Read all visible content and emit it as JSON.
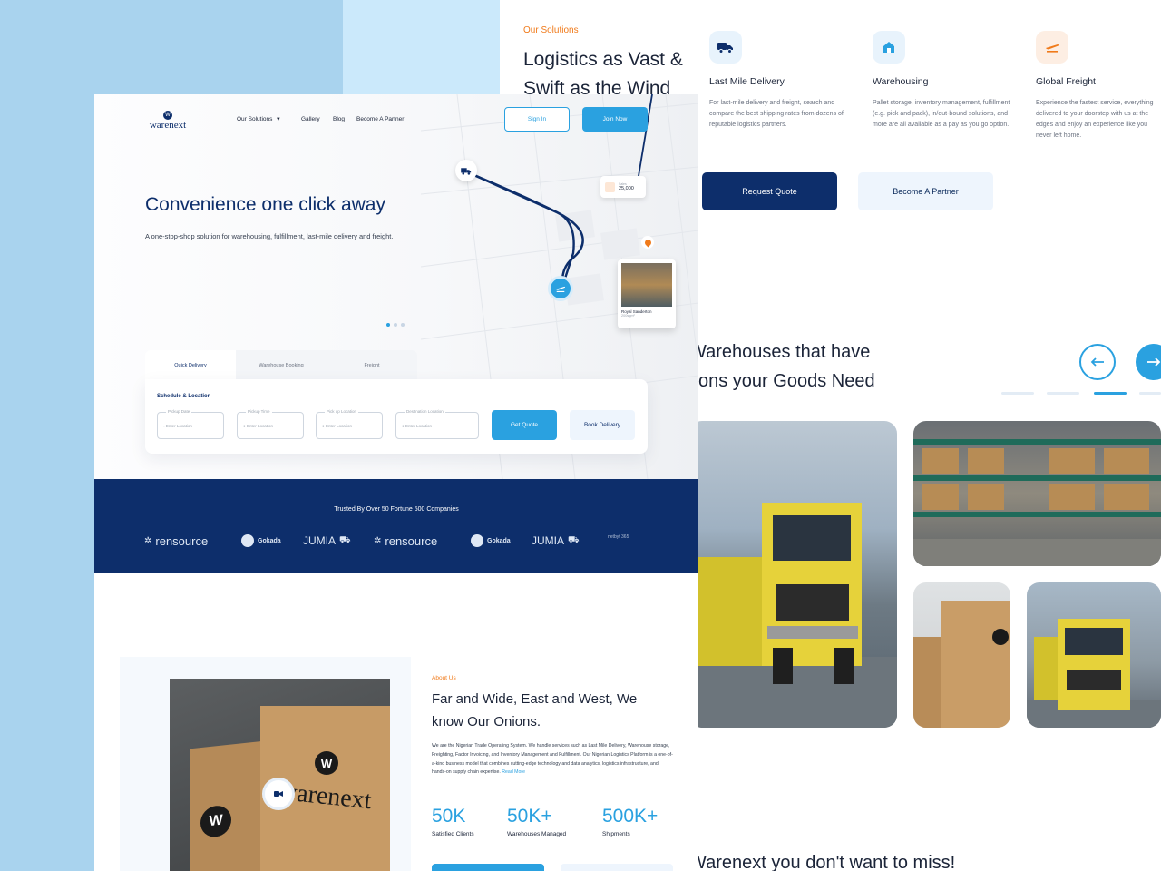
{
  "colors": {
    "navy": "#0d2e6b",
    "accent": "#2aa1e0",
    "orange": "#f07a1a",
    "bg_blue": "#a9d3ee"
  },
  "solutions": {
    "eyebrow": "Our Solutions",
    "title": "Logistics as Vast & Swift as the Wind",
    "services": [
      {
        "icon": "truck-icon",
        "title": "Last Mile Delivery",
        "desc": "For last-mile delivery and freight, search and compare the best shipping rates from dozens of reputable logistics partners."
      },
      {
        "icon": "warehouse-icon",
        "title": "Warehousing",
        "desc": "Pallet storage, inventory management, fulfillment (e.g. pick and pack), in/out-bound solutions, and more are all available as a pay as you go option."
      },
      {
        "icon": "plane-icon",
        "title": "Global Freight",
        "desc": "Experience the fastest service, everything delivered to your doorstep with us at the edges and enjoy an experience like you never left home."
      }
    ],
    "request_quote": "Request Quote",
    "become_partner": "Become A Partner"
  },
  "warehouses": {
    "title_line1": "Warehouses that have",
    "title_line2": "tions your Goods Need"
  },
  "bottom_heading": "Warenext you don't want to miss!",
  "nav": {
    "logo": "warenext",
    "items": [
      "Our Solutions",
      "Gallery",
      "Blog",
      "Become A Partner"
    ],
    "sign_in": "Sign In",
    "join_now": "Join Now"
  },
  "hero": {
    "title": "Convenience one click away",
    "subtitle": "A one-stop-shop solution for warehousing, fulfillment, last-mile delivery and freight.",
    "map_badge_label": "Sales",
    "map_badge_value": "25,000",
    "map_card_title": "Royal Sanderton",
    "map_card_sub": "200sqm²"
  },
  "booking": {
    "tabs": [
      "Quick Delivery",
      "Warehouse Booking",
      "Freight"
    ],
    "section_label": "Schedule & Location",
    "fields": [
      {
        "label": "Pickup Date",
        "placeholder": "Enter Location"
      },
      {
        "label": "Pickup Time",
        "placeholder": "Enter Location"
      },
      {
        "label": "Pick up Location",
        "placeholder": "Enter Location"
      },
      {
        "label": "Destination Location",
        "placeholder": "Enter Location"
      }
    ],
    "get_quote": "Get Quote",
    "book_delivery": "Book Delivery"
  },
  "trusted": {
    "title": "Trusted By Over 50 Fortune 500 Companies",
    "brands": [
      "rensource",
      "Gokada",
      "JUMIA",
      "rensource",
      "Gokada",
      "JUMIA",
      "netbyt 365"
    ]
  },
  "about": {
    "eyebrow": "About Us",
    "title": "Far and Wide, East and West, We know Our Onions.",
    "text": "We are the Nigerian Trade Operating System. We handle services such as Last Mile Delivery, Warehouse storage, Freighting, Factor Invoicing, and Inventory Management and Fulfillment. Our Nigerian Logistics Platform is a one-of-a-kind business model that combines cutting-edge technology and data analytics, logistics infrastructure, and hands-on supply chain expertise.",
    "read_more": "Read More",
    "box_brand": "warenext",
    "stats": [
      {
        "value": "50K",
        "label": "Satisfied Clients"
      },
      {
        "value": "50K+",
        "label": "Warehouses Managed"
      },
      {
        "value": "500K+",
        "label": "Shipments"
      }
    ]
  }
}
